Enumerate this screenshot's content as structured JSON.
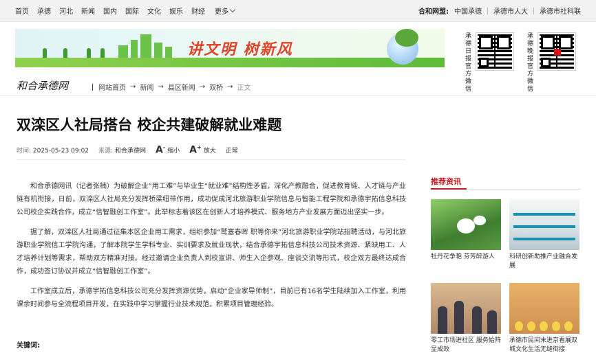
{
  "topnav": {
    "links": [
      "首页",
      "承德",
      "河北",
      "新闻",
      "国内",
      "国际",
      "文化",
      "娱乐",
      "财经"
    ],
    "more": "更多",
    "partners_label": "合和网盟:",
    "partners": [
      "中国承德",
      "承德市人大",
      "承德市社科联"
    ]
  },
  "banner": {
    "slogan": "讲文明 树新风",
    "qr1_label": "承德日报官方微信",
    "qr2_label": "承德晚报官方微信"
  },
  "site": {
    "logo": "和合承德网",
    "breadcrumb": [
      "网站首页",
      "新闻",
      "县区新闻",
      "双桥",
      "正文"
    ]
  },
  "article": {
    "title": "双滦区人社局搭台 校企共建破解就业难题",
    "time_label": "时间:",
    "time": "2025-05-23 09:02",
    "source_label": "来源:",
    "source": "和合承德网",
    "shrink": "缩小",
    "enlarge": "放大",
    "normal": "正常",
    "paragraphs": [
      "和合承德网讯（记者张楠）为破解企业“用工难”与毕业生“就业难”结构性矛盾，深化产教融合，促进教育链、人才链与产业链有机衔接，日前，双滦区人社局充分发挥桥梁纽带作用，成功促成河北旅游职业学院信息与智能工程学院和承德宇拓信息科技公司校企实践合作，成立“信智融创工作室”。此举标志着该区在创新人才培养模式、服务地方产业发展方面迈出坚实一步。",
      "据了解，双滦区人社局通过征集本区企业用工需求，组织参加“鹫塞春晖 职等你来”河北旅游职业学院站招聘活动，与河北旅游职业学院信工学院沟通，了解本院学生学科专业、实训要求及就业现状，结合承德宇拓信息科技公司技术资源、紧缺用工、人才培养计划等需求，帮助双方精准对接。经过邀请企业负责人到校宣讲、师生入企参观、座谈交流等形式，校企双方最终达成合作，成功签订协议并成立“信智融创工作室”。",
      "工作室成立后，承德宇拓信息科技公司充分发挥资源优势，启动“企业家导师制”，目前已有16名学生陆续加入工作室，利用课余时间参与全流程项目开发，在实践中学习掌握行业技术规范，积累项目管理经验。"
    ],
    "keywords_label": "关键词:"
  },
  "recommend": {
    "heading": "推荐资讯",
    "items": [
      {
        "caption": "牡丹花争艳 芬芳醉游人"
      },
      {
        "caption": "科研创新助推产业融合发展"
      },
      {
        "caption": "零工市场进社区 服务始阵显成效"
      },
      {
        "caption": "承德市民间末进京看展双城文化生活无缝衔接"
      }
    ]
  },
  "colors": {
    "accent": "#c8161d",
    "slogan": "#e0452a"
  }
}
